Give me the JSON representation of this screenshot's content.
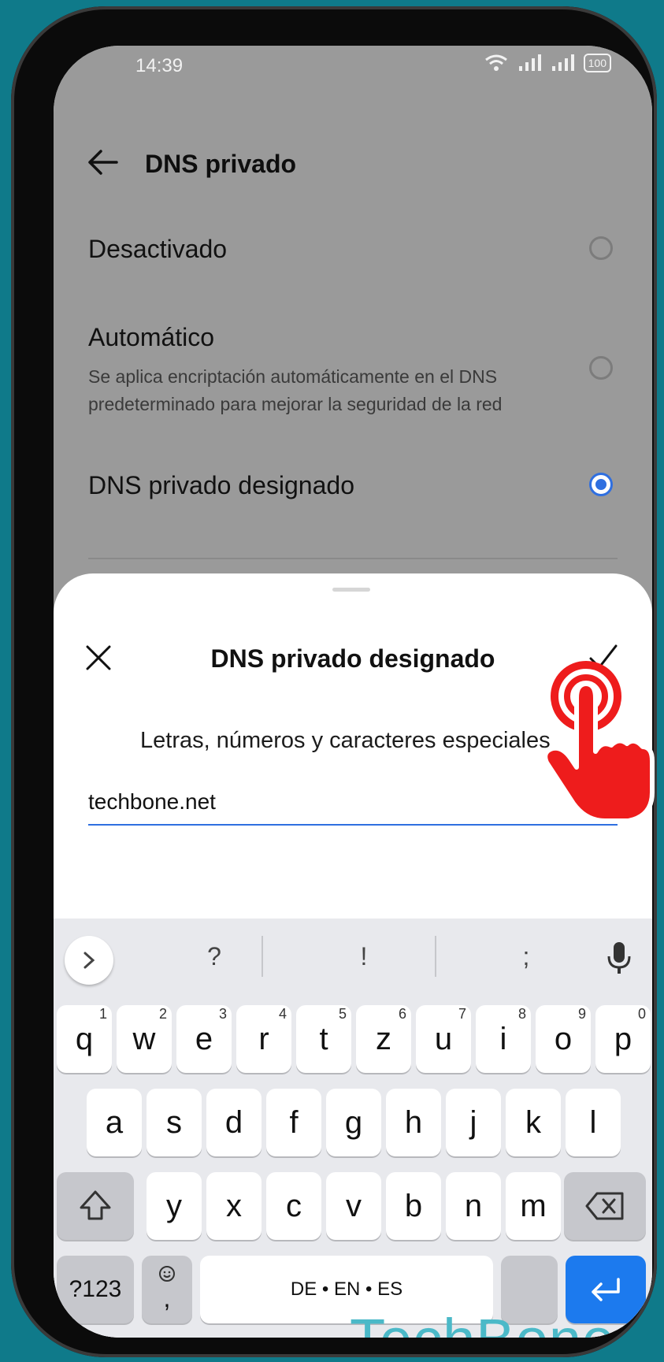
{
  "status": {
    "time": "14:39",
    "battery": "100"
  },
  "header": {
    "title": "DNS privado"
  },
  "options": [
    {
      "label": "Desactivado",
      "description": "",
      "selected": false
    },
    {
      "label": "Automático",
      "description": "Se aplica encriptación automáticamente en el DNS predeterminado para mejorar la seguridad de la red",
      "selected": false
    },
    {
      "label": "DNS privado designado",
      "description": "",
      "selected": true
    }
  ],
  "sheet": {
    "title": "DNS privado designado",
    "hint": "Letras, números y caracteres especiales",
    "hostname_value": "techbone.net"
  },
  "keyboard": {
    "suggestions": [
      "?",
      "!",
      ";"
    ],
    "row1": [
      {
        "k": "q",
        "s": "1"
      },
      {
        "k": "w",
        "s": "2"
      },
      {
        "k": "e",
        "s": "3"
      },
      {
        "k": "r",
        "s": "4"
      },
      {
        "k": "t",
        "s": "5"
      },
      {
        "k": "z",
        "s": "6"
      },
      {
        "k": "u",
        "s": "7"
      },
      {
        "k": "i",
        "s": "8"
      },
      {
        "k": "o",
        "s": "9"
      },
      {
        "k": "p",
        "s": "0"
      }
    ],
    "row2": [
      "a",
      "s",
      "d",
      "f",
      "g",
      "h",
      "j",
      "k",
      "l"
    ],
    "row3": [
      "y",
      "x",
      "c",
      "v",
      "b",
      "n",
      "m"
    ],
    "symbols_label": "?123",
    "comma_label": ",",
    "space_label": "DE • EN • ES"
  },
  "watermark": "TechBone",
  "colors": {
    "accent": "#2f6fe0",
    "enter_key": "#1c7aee",
    "hand": "#ee1c1c"
  }
}
